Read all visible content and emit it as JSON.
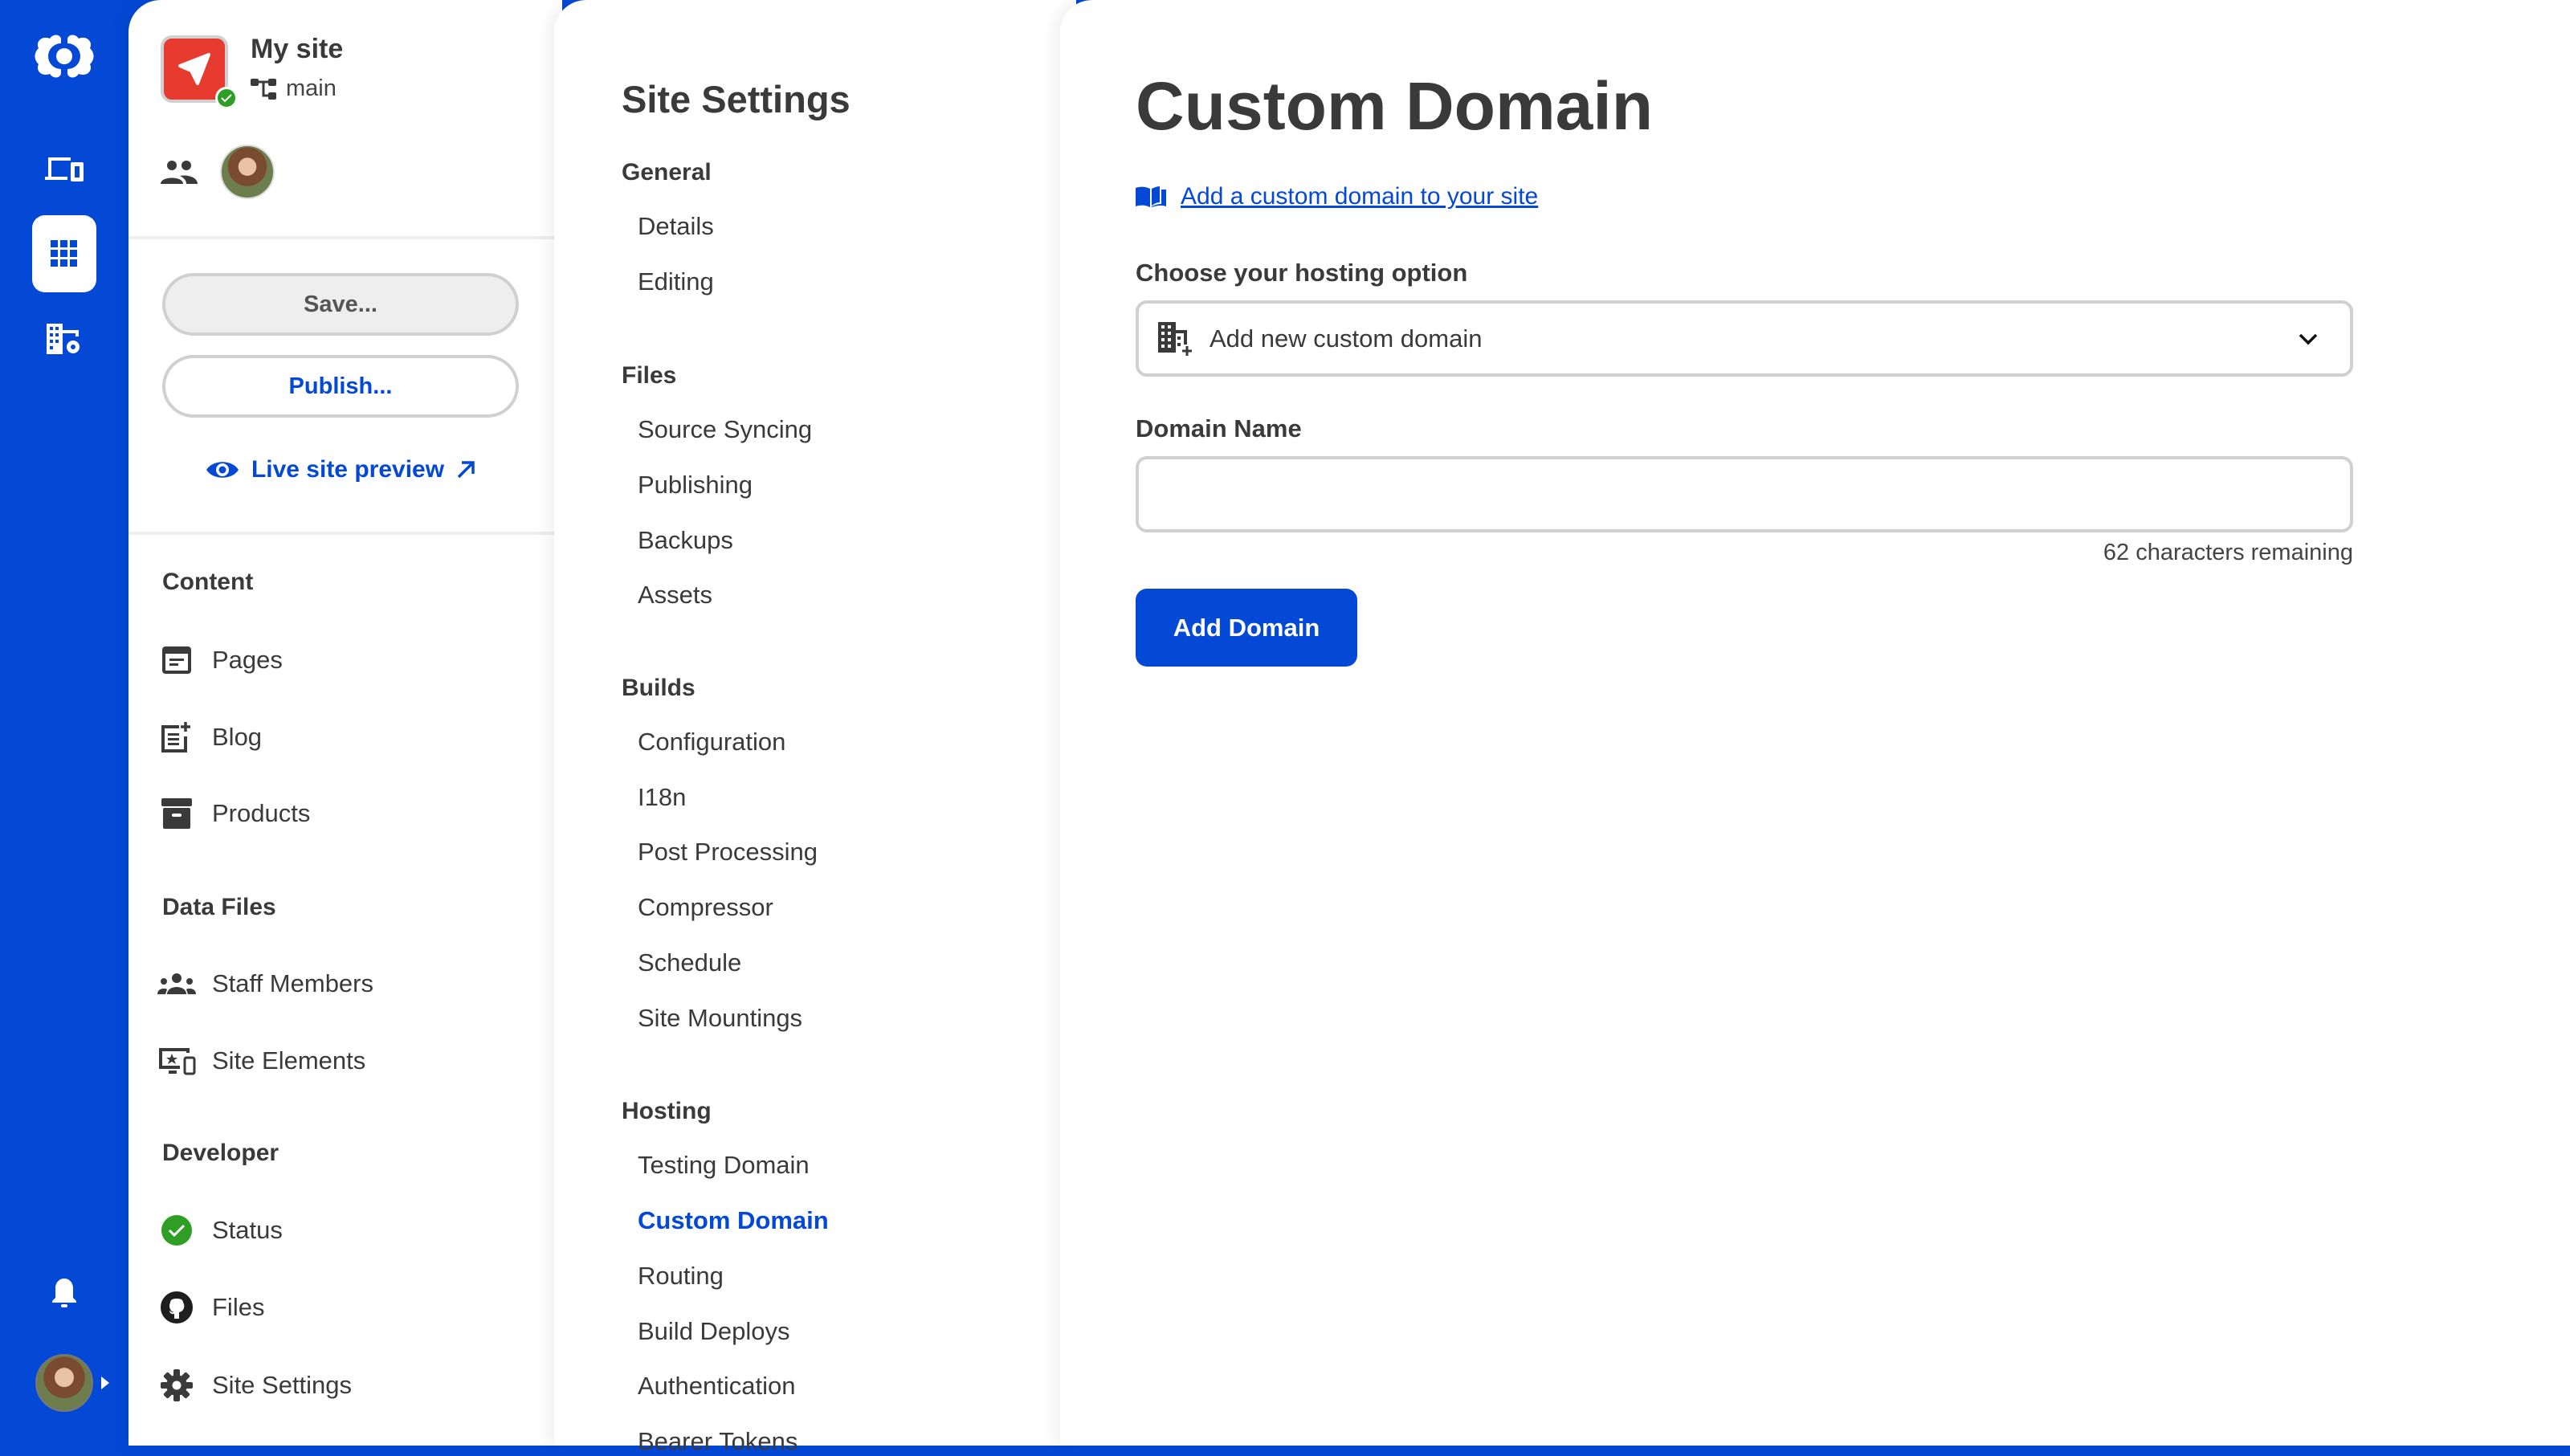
{
  "colors": {
    "brand": "#0448D6",
    "site_icon": "#E63B2E",
    "success": "#2E9E24",
    "text": "#3a3a3a",
    "border": "#d0d0d0"
  },
  "rail": {
    "items": [
      {
        "icon": "logo-icon"
      },
      {
        "icon": "devices-icon"
      },
      {
        "icon": "apps-grid-icon",
        "active": true
      },
      {
        "icon": "building-settings-icon"
      },
      {
        "icon": "bell-icon"
      },
      {
        "icon": "user-avatar"
      }
    ]
  },
  "site": {
    "name": "My site",
    "branch": "main",
    "status": "published"
  },
  "actions": {
    "save_label": "Save...",
    "publish_label": "Publish...",
    "preview_label": "Live site preview"
  },
  "nav": {
    "sections": [
      {
        "title": "Content",
        "items": [
          {
            "label": "Pages",
            "icon": "page-icon"
          },
          {
            "label": "Blog",
            "icon": "post-add-icon"
          },
          {
            "label": "Products",
            "icon": "archive-box-icon"
          }
        ]
      },
      {
        "title": "Data Files",
        "items": [
          {
            "label": "Staff Members",
            "icon": "group-icon"
          },
          {
            "label": "Site Elements",
            "icon": "devices-star-icon"
          }
        ]
      },
      {
        "title": "Developer",
        "items": [
          {
            "label": "Status",
            "icon": "check-circle-icon"
          },
          {
            "label": "Files",
            "icon": "github-icon"
          },
          {
            "label": "Site Settings",
            "icon": "gear-icon"
          }
        ]
      }
    ]
  },
  "settings": {
    "title": "Site Settings",
    "groups": [
      {
        "title": "General",
        "items": [
          "Details",
          "Editing"
        ]
      },
      {
        "title": "Files",
        "items": [
          "Source Syncing",
          "Publishing",
          "Backups",
          "Assets"
        ]
      },
      {
        "title": "Builds",
        "items": [
          "Configuration",
          "I18n",
          "Post Processing",
          "Compressor",
          "Schedule",
          "Site Mountings"
        ]
      },
      {
        "title": "Hosting",
        "items": [
          "Testing Domain",
          "Custom Domain",
          "Routing",
          "Build Deploys",
          "Authentication",
          "Bearer Tokens"
        ]
      }
    ],
    "active_item": "Custom Domain"
  },
  "main": {
    "title": "Custom Domain",
    "doc_link": "Add a custom domain to your site",
    "hosting_label": "Choose your hosting option",
    "hosting_value": "Add new custom domain",
    "domain_label": "Domain Name",
    "domain_value": "",
    "domain_placeholder": "",
    "chars_remaining": "62 characters remaining",
    "submit_label": "Add Domain"
  }
}
